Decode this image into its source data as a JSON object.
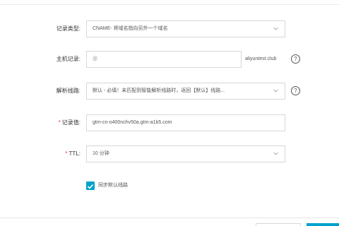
{
  "form": {
    "record_type": {
      "label": "记录类型:",
      "value": "CNAME- 将域名指向另外一个域名"
    },
    "host": {
      "label": "主机记录:",
      "value": "@",
      "suffix": "aliyuntest.club"
    },
    "line": {
      "label": "解析线路:",
      "value": "默认 - 必填！未匹配到智能解析线路时，返回【默认】线路..."
    },
    "record_value": {
      "required_mark": "*",
      "label": "记录值:",
      "value": "gtm-cn-o400nchv50a.gtm-a1b5.com"
    },
    "ttl": {
      "required_mark": "*",
      "label": "TTL:",
      "value": "10 分钟"
    },
    "sync_default": {
      "label": "同步默认线路",
      "checked": true
    }
  },
  "icons": {
    "help": "question-circle-icon",
    "dropdown": "chevron-down-icon",
    "check": "checkmark-icon"
  },
  "colors": {
    "accent": "#00a2ca",
    "required": "#e4393c",
    "border": "#d7d7d7"
  }
}
